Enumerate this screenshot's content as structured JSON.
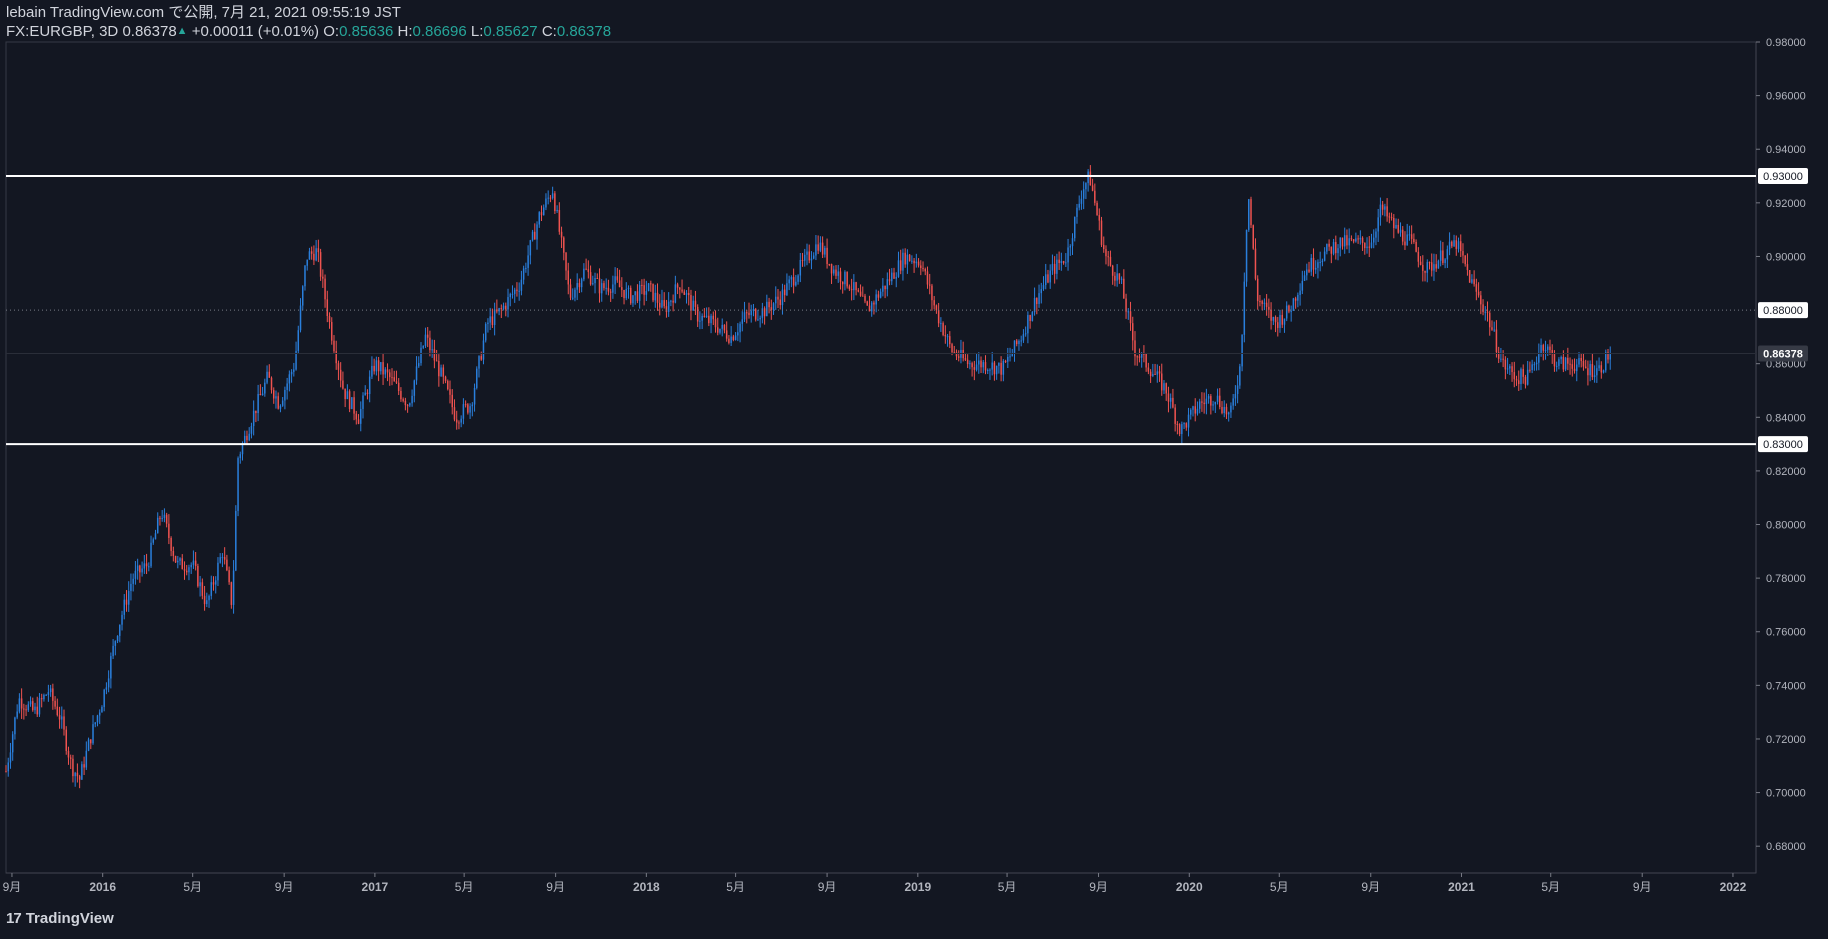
{
  "header": {
    "published": "lebain TradingView.com で公開, 7月 21, 2021 09:55:19 JST",
    "symbol": "FX:EURGBP, 3D",
    "last": "0.86378",
    "arrow": "▲",
    "change": "+0.00011 (+0.01%)",
    "o_label": "O:",
    "o_value": "0.85636",
    "h_label": "H:",
    "h_value": "0.86696",
    "l_label": "L:",
    "l_value": "0.85627",
    "c_label": "C:",
    "c_value": "0.86378"
  },
  "footer": {
    "brand": "TradingView",
    "logo": "17"
  },
  "colors": {
    "background": "#131722",
    "up": "#2a7fdc",
    "down": "#ef5350",
    "grid": "#2a2e39",
    "text": "#d1d4dc",
    "level_line": "#ffffff",
    "last_tag": "#363a45"
  },
  "chart_data": {
    "type": "candlestick",
    "ylim": [
      0.67,
      0.98
    ],
    "y_ticks": [
      "0.98000",
      "0.96000",
      "0.94000",
      "0.93000",
      "0.92000",
      "0.90000",
      "0.88000",
      "0.86378",
      "0.86000",
      "0.84000",
      "0.83000",
      "0.82000",
      "0.80000",
      "0.78000",
      "0.76000",
      "0.74000",
      "0.72000",
      "0.70000",
      "0.68000"
    ],
    "x_tick_labels": [
      "9月",
      "2016",
      "5月",
      "9月",
      "2017",
      "5月",
      "9月",
      "2018",
      "5月",
      "9月",
      "2019",
      "5月",
      "9月",
      "2020",
      "5月",
      "9月",
      "2021",
      "5月",
      "9月",
      "2022"
    ],
    "x_tick_dates": [
      "2015-09-01",
      "2016-01-01",
      "2016-05-01",
      "2016-09-01",
      "2017-01-01",
      "2017-05-01",
      "2017-09-01",
      "2018-01-01",
      "2018-05-01",
      "2018-09-01",
      "2019-01-01",
      "2019-05-01",
      "2019-09-01",
      "2020-01-01",
      "2020-05-01",
      "2020-09-01",
      "2021-01-01",
      "2021-05-01",
      "2021-09-01",
      "2022-01-01"
    ],
    "x_range": [
      "2015-08-24",
      "2022-02-01"
    ],
    "horizontal_lines": [
      {
        "value": 0.93,
        "label": "0.93000",
        "style": "solid"
      },
      {
        "value": 0.83,
        "label": "0.83000",
        "style": "solid"
      },
      {
        "value": 0.88,
        "label": "0.88000",
        "style": "dotted"
      }
    ],
    "last_price": {
      "value": 0.86378,
      "label": "0.86378"
    },
    "close_path": [
      [
        "2015-08-24",
        0.708
      ],
      [
        "2015-09-10",
        0.735
      ],
      [
        "2015-10-01",
        0.73
      ],
      [
        "2015-10-20",
        0.738
      ],
      [
        "2015-11-05",
        0.728
      ],
      [
        "2015-11-20",
        0.71
      ],
      [
        "2015-12-01",
        0.705
      ],
      [
        "2015-12-15",
        0.72
      ],
      [
        "2016-01-01",
        0.735
      ],
      [
        "2016-01-20",
        0.76
      ],
      [
        "2016-02-10",
        0.78
      ],
      [
        "2016-03-01",
        0.785
      ],
      [
        "2016-03-20",
        0.805
      ],
      [
        "2016-04-10",
        0.785
      ],
      [
        "2016-05-01",
        0.785
      ],
      [
        "2016-05-20",
        0.77
      ],
      [
        "2016-06-10",
        0.79
      ],
      [
        "2016-06-23",
        0.77
      ],
      [
        "2016-07-01",
        0.825
      ],
      [
        "2016-07-20",
        0.84
      ],
      [
        "2016-08-10",
        0.855
      ],
      [
        "2016-08-25",
        0.845
      ],
      [
        "2016-09-15",
        0.86
      ],
      [
        "2016-10-01",
        0.9
      ],
      [
        "2016-10-15",
        0.902
      ],
      [
        "2016-11-01",
        0.875
      ],
      [
        "2016-11-20",
        0.85
      ],
      [
        "2016-12-10",
        0.84
      ],
      [
        "2017-01-01",
        0.86
      ],
      [
        "2017-01-20",
        0.855
      ],
      [
        "2017-02-15",
        0.845
      ],
      [
        "2017-03-10",
        0.87
      ],
      [
        "2017-04-01",
        0.855
      ],
      [
        "2017-04-20",
        0.84
      ],
      [
        "2017-05-10",
        0.845
      ],
      [
        "2017-06-01",
        0.875
      ],
      [
        "2017-06-20",
        0.88
      ],
      [
        "2017-07-15",
        0.89
      ],
      [
        "2017-08-10",
        0.915
      ],
      [
        "2017-08-28",
        0.925
      ],
      [
        "2017-09-20",
        0.885
      ],
      [
        "2017-10-10",
        0.895
      ],
      [
        "2017-11-01",
        0.888
      ],
      [
        "2017-11-20",
        0.89
      ],
      [
        "2017-12-10",
        0.885
      ],
      [
        "2018-01-05",
        0.888
      ],
      [
        "2018-01-25",
        0.88
      ],
      [
        "2018-02-15",
        0.89
      ],
      [
        "2018-03-10",
        0.878
      ],
      [
        "2018-04-01",
        0.875
      ],
      [
        "2018-04-25",
        0.87
      ],
      [
        "2018-05-15",
        0.878
      ],
      [
        "2018-06-10",
        0.88
      ],
      [
        "2018-07-01",
        0.885
      ],
      [
        "2018-07-25",
        0.895
      ],
      [
        "2018-08-20",
        0.905
      ],
      [
        "2018-09-10",
        0.895
      ],
      [
        "2018-10-01",
        0.89
      ],
      [
        "2018-10-25",
        0.88
      ],
      [
        "2018-11-20",
        0.89
      ],
      [
        "2018-12-15",
        0.9
      ],
      [
        "2019-01-05",
        0.898
      ],
      [
        "2019-01-25",
        0.88
      ],
      [
        "2019-02-15",
        0.865
      ],
      [
        "2019-03-10",
        0.86
      ],
      [
        "2019-04-01",
        0.86
      ],
      [
        "2019-04-25",
        0.858
      ],
      [
        "2019-05-20",
        0.87
      ],
      [
        "2019-06-10",
        0.885
      ],
      [
        "2019-07-01",
        0.895
      ],
      [
        "2019-07-20",
        0.9
      ],
      [
        "2019-08-10",
        0.925
      ],
      [
        "2019-08-20",
        0.93
      ],
      [
        "2019-09-10",
        0.9
      ],
      [
        "2019-10-01",
        0.89
      ],
      [
        "2019-10-20",
        0.865
      ],
      [
        "2019-11-10",
        0.858
      ],
      [
        "2019-12-01",
        0.85
      ],
      [
        "2019-12-20",
        0.835
      ],
      [
        "2020-01-15",
        0.845
      ],
      [
        "2020-02-05",
        0.848
      ],
      [
        "2020-02-25",
        0.84
      ],
      [
        "2020-03-10",
        0.86
      ],
      [
        "2020-03-20",
        0.925
      ],
      [
        "2020-04-01",
        0.885
      ],
      [
        "2020-04-25",
        0.875
      ],
      [
        "2020-05-15",
        0.88
      ],
      [
        "2020-06-05",
        0.895
      ],
      [
        "2020-06-25",
        0.9
      ],
      [
        "2020-07-20",
        0.905
      ],
      [
        "2020-08-10",
        0.905
      ],
      [
        "2020-09-01",
        0.905
      ],
      [
        "2020-09-15",
        0.918
      ],
      [
        "2020-10-05",
        0.91
      ],
      [
        "2020-10-25",
        0.905
      ],
      [
        "2020-11-15",
        0.895
      ],
      [
        "2020-12-05",
        0.9
      ],
      [
        "2020-12-25",
        0.905
      ],
      [
        "2021-01-15",
        0.89
      ],
      [
        "2021-02-05",
        0.878
      ],
      [
        "2021-02-25",
        0.86
      ],
      [
        "2021-03-15",
        0.855
      ],
      [
        "2021-04-01",
        0.855
      ],
      [
        "2021-04-20",
        0.868
      ],
      [
        "2021-05-10",
        0.86
      ],
      [
        "2021-06-01",
        0.86
      ],
      [
        "2021-06-20",
        0.858
      ],
      [
        "2021-07-05",
        0.858
      ],
      [
        "2021-07-20",
        0.864
      ]
    ]
  }
}
